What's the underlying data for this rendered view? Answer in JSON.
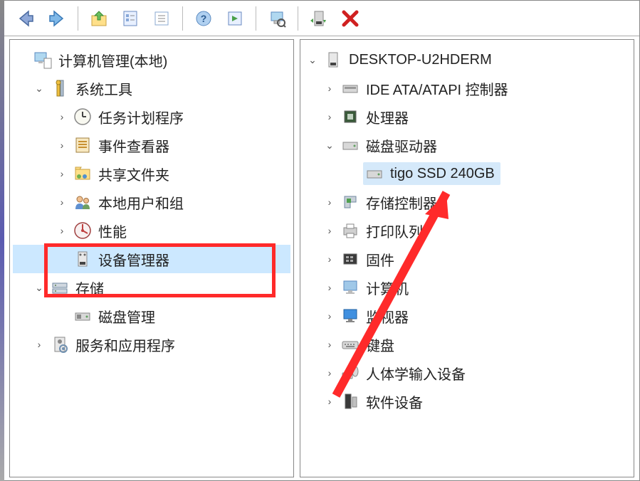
{
  "toolbar": {
    "back": "back-icon",
    "forward": "forward-icon",
    "up": "up-icon",
    "props": "properties-icon",
    "refresh": "refresh-icon",
    "help": "help-icon",
    "view": "view-icon",
    "configure": "configure-icon",
    "install": "install-icon",
    "remove": "remove-icon"
  },
  "left_tree": {
    "root": "计算机管理(本地)",
    "system_tools": "系统工具",
    "task_scheduler": "任务计划程序",
    "event_viewer": "事件查看器",
    "shared_folders": "共享文件夹",
    "local_users": "本地用户和组",
    "performance": "性能",
    "device_manager": "设备管理器",
    "storage": "存储",
    "disk_management": "磁盘管理",
    "services": "服务和应用程序"
  },
  "right_tree": {
    "computer": "DESKTOP-U2HDERM",
    "ide": "IDE ATA/ATAPI 控制器",
    "processor": "处理器",
    "disk_drives": "磁盘驱动器",
    "disk_item": "tigo SSD 240GB",
    "storage_ctrl": "存储控制器",
    "print_queue": "打印队列",
    "firmware": "固件",
    "computer_cat": "计算机",
    "monitor": "监视器",
    "keyboard": "键盘",
    "hid": "人体学输入设备",
    "software": "软件设备"
  }
}
